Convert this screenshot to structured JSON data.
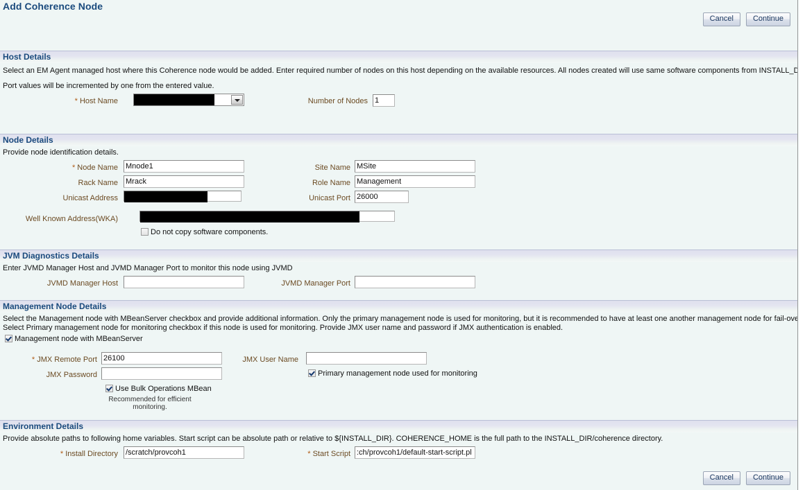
{
  "page": {
    "title": "Add Coherence Node"
  },
  "toolbar": {
    "cancel_label": "Cancel",
    "continue_label": "Continue"
  },
  "sections": {
    "host": {
      "title": "Host Details",
      "desc_line1": "Select an EM Agent managed host where this Coherence node would be added. Enter required number of nodes on this host depending on the available resources. All nodes created will use same software components from INSTALL_DIR.",
      "desc_line2": "Port values will be incremented by one from the entered value.",
      "host_name_label": "Host Name",
      "host_name_value": "",
      "number_of_nodes_label": "Number of Nodes",
      "number_of_nodes_value": "1"
    },
    "node": {
      "title": "Node Details",
      "desc": "Provide node identification details.",
      "node_name_label": "Node Name",
      "node_name_value": "Mnode1",
      "site_name_label": "Site Name",
      "site_name_value": "MSite",
      "rack_name_label": "Rack Name",
      "rack_name_value": "Mrack",
      "role_name_label": "Role Name",
      "role_name_value": "Management",
      "unicast_address_label": "Unicast Address",
      "unicast_address_value": "",
      "unicast_port_label": "Unicast Port",
      "unicast_port_value": "26000",
      "wka_label": "Well Known Address(WKA)",
      "wka_value": "",
      "do_not_copy_label": "Do not copy software components.",
      "do_not_copy_checked": false
    },
    "jvmd": {
      "title": "JVM Diagnostics Details",
      "desc": "Enter JVMD Manager Host and JVMD Manager Port to monitor this node using JVMD",
      "manager_host_label": "JVMD Manager Host",
      "manager_host_value": "",
      "manager_port_label": "JVMD Manager Port",
      "manager_port_value": ""
    },
    "management": {
      "title": "Management Node Details",
      "desc_line1": "Select the Management node with MBeanServer checkbox and provide additional information. Only the primary management node is used for monitoring, but it is recommended to have at least one another management node for fail-over.",
      "desc_line2": "Select Primary management node for monitoring checkbox if this node is used for monitoring. Provide JMX user name and password if JMX authentication is enabled.",
      "mbean_server_label": "Management node with MBeanServer",
      "mbean_server_checked": true,
      "jmx_remote_port_label": "JMX Remote Port",
      "jmx_remote_port_value": "26100",
      "jmx_user_name_label": "JMX User Name",
      "jmx_user_name_value": "",
      "jmx_password_label": "JMX Password",
      "jmx_password_value": "",
      "primary_node_label": "Primary management node used for monitoring",
      "primary_node_checked": true,
      "bulk_ops_label": "Use Bulk Operations MBean",
      "bulk_ops_checked": true,
      "bulk_ops_hint": "Recommended for efficient monitoring."
    },
    "environment": {
      "title": "Environment Details",
      "desc": "Provide absolute paths to following home variables. Start script can be absolute path or relative to ${INSTALL_DIR}. COHERENCE_HOME is the full path to the INSTALL_DIR/coherence directory.",
      "install_directory_label": "Install Directory",
      "install_directory_value": "/scratch/provcoh1",
      "start_script_label": "Start Script",
      "start_script_value": ":ch/provcoh1/default-start-script.pl"
    }
  },
  "colors": {
    "page_background": "#eff6f5",
    "section_header_start": "#dfe0ee",
    "heading_blue": "#1a4a7d",
    "field_label_brown": "#6b4a22",
    "required_marker": "#b05a14"
  }
}
